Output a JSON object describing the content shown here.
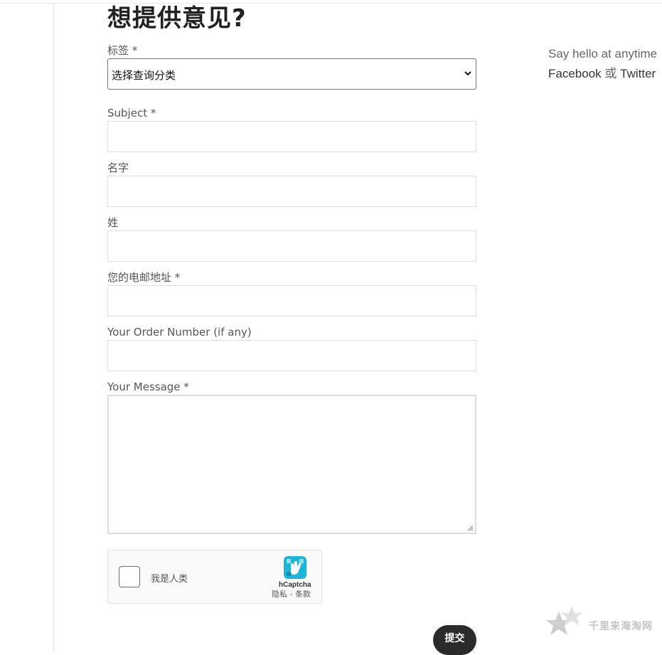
{
  "page": {
    "title": "想提供意见?"
  },
  "form": {
    "tag": {
      "label": "标签 *",
      "selected": "选择查询分类"
    },
    "subject": {
      "label": "Subject *",
      "value": ""
    },
    "first_name": {
      "label": "名字",
      "value": ""
    },
    "last_name": {
      "label": "姓",
      "value": ""
    },
    "email": {
      "label": "您的电邮地址 *",
      "value": ""
    },
    "order_number": {
      "label": "Your Order Number (if any)",
      "value": ""
    },
    "message": {
      "label": "Your Message *",
      "value": ""
    },
    "captcha": {
      "label": "我是人类",
      "brand": "hCaptcha",
      "links": "隐私 - 条款"
    },
    "submit_label": "提交"
  },
  "aside": {
    "line1": "Say hello at anytime",
    "facebook": "Facebook",
    "or": "或",
    "twitter": "Twitter"
  },
  "watermark": {
    "text": "千里来海淘网"
  },
  "colors": {
    "button_bg": "#2b2b2b",
    "captcha_logo": "#1fb5d6",
    "label_text": "#555555"
  },
  "icons": {
    "select": "chevron-down-icon",
    "captcha": "hcaptcha-logo-icon",
    "textarea": "resize-grip-icon",
    "watermark": "star-icon"
  }
}
